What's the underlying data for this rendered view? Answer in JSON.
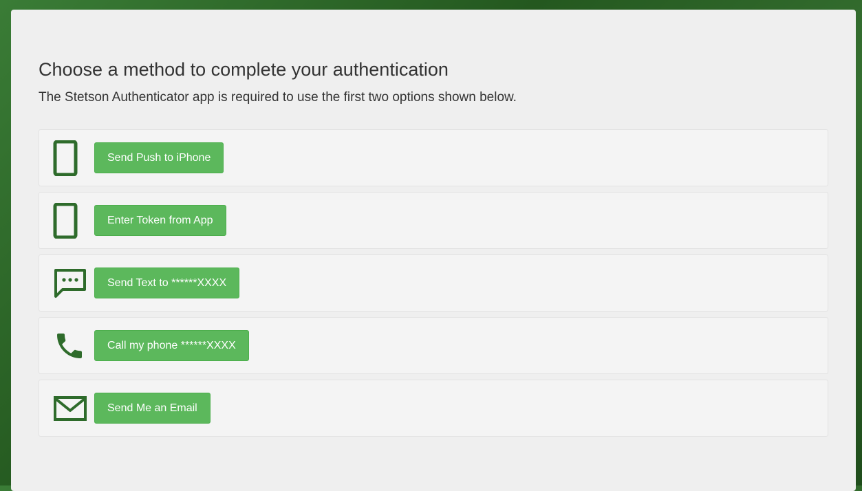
{
  "page": {
    "title": "Choose a method to complete your authentication",
    "subtitle": "The Stetson Authenticator app is required to use the first two options shown below."
  },
  "colors": {
    "accent": "#5cb85c",
    "icon": "#2e6b2b",
    "panel": "#efefef"
  },
  "options": [
    {
      "icon": "smartphone-icon",
      "label": "Send Push to iPhone"
    },
    {
      "icon": "smartphone-icon",
      "label": "Enter Token from App"
    },
    {
      "icon": "chat-bubble-icon",
      "label": "Send Text to ******XXXX"
    },
    {
      "icon": "phone-handset-icon",
      "label": "Call my phone ******XXXX"
    },
    {
      "icon": "envelope-icon",
      "label": "Send Me an Email"
    }
  ]
}
